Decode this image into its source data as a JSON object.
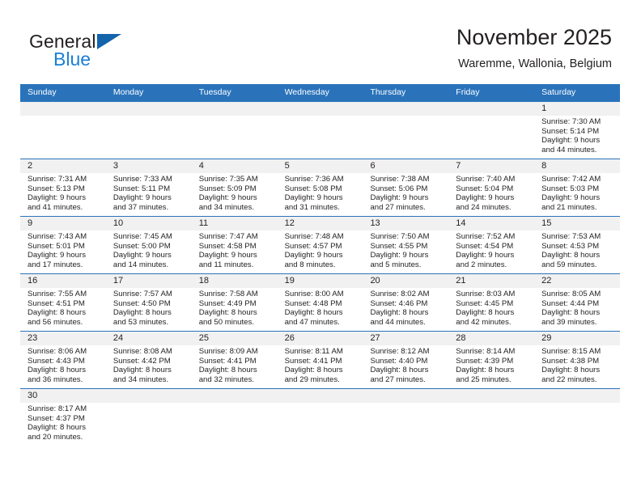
{
  "brand": {
    "name_part1": "General",
    "name_part2": "Blue",
    "triangle_color": "#1464ab",
    "blue_text_color": "#1a7fd4"
  },
  "header": {
    "title": "November 2025",
    "subtitle": "Waremme, Wallonia, Belgium"
  },
  "theme": {
    "header_band": "#2a73bb",
    "day_band": "#f1f1f1",
    "text": "#231f20"
  },
  "weekdays": [
    "Sunday",
    "Monday",
    "Tuesday",
    "Wednesday",
    "Thursday",
    "Friday",
    "Saturday"
  ],
  "weeks": [
    [
      {
        "day": "",
        "sunrise": "",
        "sunset": "",
        "daylight1": "",
        "daylight2": "",
        "empty": true
      },
      {
        "day": "",
        "sunrise": "",
        "sunset": "",
        "daylight1": "",
        "daylight2": "",
        "empty": true
      },
      {
        "day": "",
        "sunrise": "",
        "sunset": "",
        "daylight1": "",
        "daylight2": "",
        "empty": true
      },
      {
        "day": "",
        "sunrise": "",
        "sunset": "",
        "daylight1": "",
        "daylight2": "",
        "empty": true
      },
      {
        "day": "",
        "sunrise": "",
        "sunset": "",
        "daylight1": "",
        "daylight2": "",
        "empty": true
      },
      {
        "day": "",
        "sunrise": "",
        "sunset": "",
        "daylight1": "",
        "daylight2": "",
        "empty": true
      },
      {
        "day": "1",
        "sunrise": "Sunrise: 7:30 AM",
        "sunset": "Sunset: 5:14 PM",
        "daylight1": "Daylight: 9 hours",
        "daylight2": "and 44 minutes.",
        "empty": false
      }
    ],
    [
      {
        "day": "2",
        "sunrise": "Sunrise: 7:31 AM",
        "sunset": "Sunset: 5:13 PM",
        "daylight1": "Daylight: 9 hours",
        "daylight2": "and 41 minutes.",
        "empty": false
      },
      {
        "day": "3",
        "sunrise": "Sunrise: 7:33 AM",
        "sunset": "Sunset: 5:11 PM",
        "daylight1": "Daylight: 9 hours",
        "daylight2": "and 37 minutes.",
        "empty": false
      },
      {
        "day": "4",
        "sunrise": "Sunrise: 7:35 AM",
        "sunset": "Sunset: 5:09 PM",
        "daylight1": "Daylight: 9 hours",
        "daylight2": "and 34 minutes.",
        "empty": false
      },
      {
        "day": "5",
        "sunrise": "Sunrise: 7:36 AM",
        "sunset": "Sunset: 5:08 PM",
        "daylight1": "Daylight: 9 hours",
        "daylight2": "and 31 minutes.",
        "empty": false
      },
      {
        "day": "6",
        "sunrise": "Sunrise: 7:38 AM",
        "sunset": "Sunset: 5:06 PM",
        "daylight1": "Daylight: 9 hours",
        "daylight2": "and 27 minutes.",
        "empty": false
      },
      {
        "day": "7",
        "sunrise": "Sunrise: 7:40 AM",
        "sunset": "Sunset: 5:04 PM",
        "daylight1": "Daylight: 9 hours",
        "daylight2": "and 24 minutes.",
        "empty": false
      },
      {
        "day": "8",
        "sunrise": "Sunrise: 7:42 AM",
        "sunset": "Sunset: 5:03 PM",
        "daylight1": "Daylight: 9 hours",
        "daylight2": "and 21 minutes.",
        "empty": false
      }
    ],
    [
      {
        "day": "9",
        "sunrise": "Sunrise: 7:43 AM",
        "sunset": "Sunset: 5:01 PM",
        "daylight1": "Daylight: 9 hours",
        "daylight2": "and 17 minutes.",
        "empty": false
      },
      {
        "day": "10",
        "sunrise": "Sunrise: 7:45 AM",
        "sunset": "Sunset: 5:00 PM",
        "daylight1": "Daylight: 9 hours",
        "daylight2": "and 14 minutes.",
        "empty": false
      },
      {
        "day": "11",
        "sunrise": "Sunrise: 7:47 AM",
        "sunset": "Sunset: 4:58 PM",
        "daylight1": "Daylight: 9 hours",
        "daylight2": "and 11 minutes.",
        "empty": false
      },
      {
        "day": "12",
        "sunrise": "Sunrise: 7:48 AM",
        "sunset": "Sunset: 4:57 PM",
        "daylight1": "Daylight: 9 hours",
        "daylight2": "and 8 minutes.",
        "empty": false
      },
      {
        "day": "13",
        "sunrise": "Sunrise: 7:50 AM",
        "sunset": "Sunset: 4:55 PM",
        "daylight1": "Daylight: 9 hours",
        "daylight2": "and 5 minutes.",
        "empty": false
      },
      {
        "day": "14",
        "sunrise": "Sunrise: 7:52 AM",
        "sunset": "Sunset: 4:54 PM",
        "daylight1": "Daylight: 9 hours",
        "daylight2": "and 2 minutes.",
        "empty": false
      },
      {
        "day": "15",
        "sunrise": "Sunrise: 7:53 AM",
        "sunset": "Sunset: 4:53 PM",
        "daylight1": "Daylight: 8 hours",
        "daylight2": "and 59 minutes.",
        "empty": false
      }
    ],
    [
      {
        "day": "16",
        "sunrise": "Sunrise: 7:55 AM",
        "sunset": "Sunset: 4:51 PM",
        "daylight1": "Daylight: 8 hours",
        "daylight2": "and 56 minutes.",
        "empty": false
      },
      {
        "day": "17",
        "sunrise": "Sunrise: 7:57 AM",
        "sunset": "Sunset: 4:50 PM",
        "daylight1": "Daylight: 8 hours",
        "daylight2": "and 53 minutes.",
        "empty": false
      },
      {
        "day": "18",
        "sunrise": "Sunrise: 7:58 AM",
        "sunset": "Sunset: 4:49 PM",
        "daylight1": "Daylight: 8 hours",
        "daylight2": "and 50 minutes.",
        "empty": false
      },
      {
        "day": "19",
        "sunrise": "Sunrise: 8:00 AM",
        "sunset": "Sunset: 4:48 PM",
        "daylight1": "Daylight: 8 hours",
        "daylight2": "and 47 minutes.",
        "empty": false
      },
      {
        "day": "20",
        "sunrise": "Sunrise: 8:02 AM",
        "sunset": "Sunset: 4:46 PM",
        "daylight1": "Daylight: 8 hours",
        "daylight2": "and 44 minutes.",
        "empty": false
      },
      {
        "day": "21",
        "sunrise": "Sunrise: 8:03 AM",
        "sunset": "Sunset: 4:45 PM",
        "daylight1": "Daylight: 8 hours",
        "daylight2": "and 42 minutes.",
        "empty": false
      },
      {
        "day": "22",
        "sunrise": "Sunrise: 8:05 AM",
        "sunset": "Sunset: 4:44 PM",
        "daylight1": "Daylight: 8 hours",
        "daylight2": "and 39 minutes.",
        "empty": false
      }
    ],
    [
      {
        "day": "23",
        "sunrise": "Sunrise: 8:06 AM",
        "sunset": "Sunset: 4:43 PM",
        "daylight1": "Daylight: 8 hours",
        "daylight2": "and 36 minutes.",
        "empty": false
      },
      {
        "day": "24",
        "sunrise": "Sunrise: 8:08 AM",
        "sunset": "Sunset: 4:42 PM",
        "daylight1": "Daylight: 8 hours",
        "daylight2": "and 34 minutes.",
        "empty": false
      },
      {
        "day": "25",
        "sunrise": "Sunrise: 8:09 AM",
        "sunset": "Sunset: 4:41 PM",
        "daylight1": "Daylight: 8 hours",
        "daylight2": "and 32 minutes.",
        "empty": false
      },
      {
        "day": "26",
        "sunrise": "Sunrise: 8:11 AM",
        "sunset": "Sunset: 4:41 PM",
        "daylight1": "Daylight: 8 hours",
        "daylight2": "and 29 minutes.",
        "empty": false
      },
      {
        "day": "27",
        "sunrise": "Sunrise: 8:12 AM",
        "sunset": "Sunset: 4:40 PM",
        "daylight1": "Daylight: 8 hours",
        "daylight2": "and 27 minutes.",
        "empty": false
      },
      {
        "day": "28",
        "sunrise": "Sunrise: 8:14 AM",
        "sunset": "Sunset: 4:39 PM",
        "daylight1": "Daylight: 8 hours",
        "daylight2": "and 25 minutes.",
        "empty": false
      },
      {
        "day": "29",
        "sunrise": "Sunrise: 8:15 AM",
        "sunset": "Sunset: 4:38 PM",
        "daylight1": "Daylight: 8 hours",
        "daylight2": "and 22 minutes.",
        "empty": false
      }
    ],
    [
      {
        "day": "30",
        "sunrise": "Sunrise: 8:17 AM",
        "sunset": "Sunset: 4:37 PM",
        "daylight1": "Daylight: 8 hours",
        "daylight2": "and 20 minutes.",
        "empty": false
      },
      {
        "day": "",
        "sunrise": "",
        "sunset": "",
        "daylight1": "",
        "daylight2": "",
        "empty": true
      },
      {
        "day": "",
        "sunrise": "",
        "sunset": "",
        "daylight1": "",
        "daylight2": "",
        "empty": true
      },
      {
        "day": "",
        "sunrise": "",
        "sunset": "",
        "daylight1": "",
        "daylight2": "",
        "empty": true
      },
      {
        "day": "",
        "sunrise": "",
        "sunset": "",
        "daylight1": "",
        "daylight2": "",
        "empty": true
      },
      {
        "day": "",
        "sunrise": "",
        "sunset": "",
        "daylight1": "",
        "daylight2": "",
        "empty": true
      },
      {
        "day": "",
        "sunrise": "",
        "sunset": "",
        "daylight1": "",
        "daylight2": "",
        "empty": true
      }
    ]
  ]
}
